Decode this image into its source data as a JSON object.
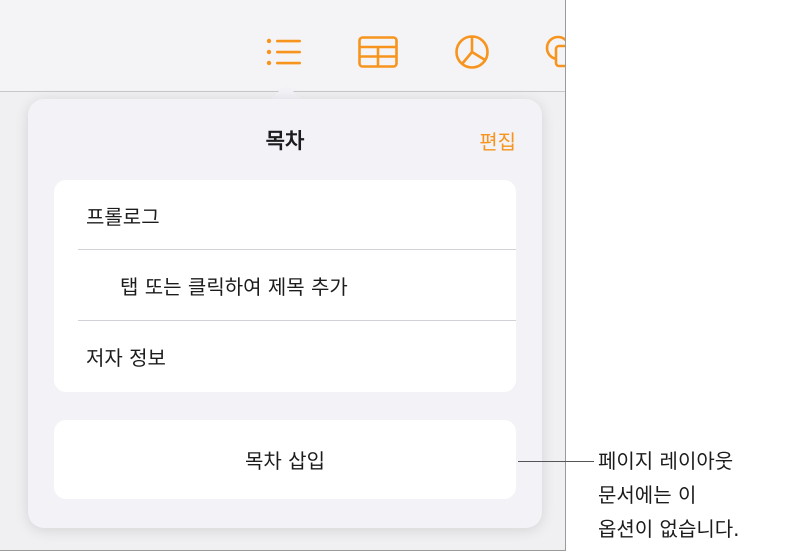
{
  "toolbar": {
    "icons": [
      "list-icon",
      "table-icon",
      "chart-icon",
      "shape-icon"
    ],
    "accent": "#f7941d"
  },
  "popover": {
    "title": "목차",
    "edit_label": "편집",
    "items": [
      {
        "label": "프롤로그"
      },
      {
        "label": "탭 또는 클릭하여 제목 추가"
      },
      {
        "label": "저자 정보"
      }
    ],
    "insert_label": "목차 삽입"
  },
  "callout": {
    "lines": [
      "페이지 레이아웃",
      "문서에는 이",
      "옵션이 없습니다."
    ]
  }
}
